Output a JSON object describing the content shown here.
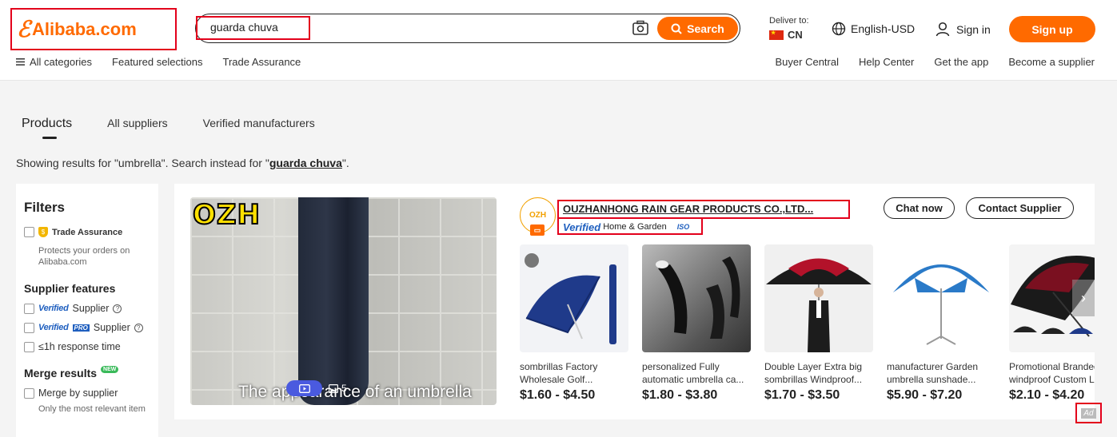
{
  "header": {
    "logo_mark": "ℰ",
    "logo_text": "Alibaba.com",
    "search": {
      "query": "guarda chuva",
      "button_label": "Search"
    },
    "deliver": {
      "label": "Deliver to:",
      "country": "CN"
    },
    "language": "English-USD",
    "sign_in": "Sign in",
    "sign_up": "Sign up",
    "nav_left": [
      "All categories",
      "Featured selections",
      "Trade Assurance"
    ],
    "nav_right": [
      "Buyer Central",
      "Help Center",
      "Get the app",
      "Become a supplier"
    ]
  },
  "tabs": [
    "Products",
    "All suppliers",
    "Verified manufacturers"
  ],
  "showing": {
    "prefix": "Showing results for \"umbrella\". Search instead for \"",
    "query": "guarda chuva",
    "suffix": "\"."
  },
  "filters": {
    "title": "Filters",
    "trade_assurance": {
      "label": "Trade Assurance",
      "note": "Protects your orders on Alibaba.com"
    },
    "supplier_features": {
      "title": "Supplier features",
      "items": [
        {
          "badge": "Verified",
          "label": "Supplier"
        },
        {
          "badge": "Verified",
          "pro": "PRO",
          "label": "Supplier"
        },
        {
          "label": "≤1h response time"
        }
      ]
    },
    "merge": {
      "title": "Merge results",
      "new_badge": "NEW",
      "item": "Merge by supplier",
      "note": "Only the most relevant item"
    }
  },
  "card": {
    "video": {
      "brand": "OZH",
      "caption": "The appearance of an umbrella",
      "image_count": "5"
    },
    "supplier": {
      "logo_text": "OZH",
      "name": "OUZHANHONG RAIN GEAR PRODUCTS CO.,LTD...",
      "verified": "Verified",
      "category": "Home & Garden",
      "iso": "ISO"
    },
    "chat_label": "Chat now",
    "contact_label": "Contact Supplier",
    "products": [
      {
        "title1": "sombrillas Factory",
        "title2": "Wholesale Golf...",
        "price": "$1.60 - $4.50"
      },
      {
        "title1": "personalized Fully",
        "title2": "automatic umbrella ca...",
        "price": "$1.80 - $3.80"
      },
      {
        "title1": "Double Layer Extra big",
        "title2": "sombrillas Windproof...",
        "price": "$1.70 - $3.50"
      },
      {
        "title1": "manufacturer Garden",
        "title2": "umbrella sunshade...",
        "price": "$5.90 - $7.20"
      },
      {
        "title1": "Promotional Branded",
        "title2": "windproof Custom L...",
        "price": "$2.10 - $4.20"
      }
    ],
    "ad_label": "Ad"
  },
  "colors": {
    "accent": "#ff6a00",
    "highlight_box": "#e3001b",
    "verified_blue": "#1f5fbf"
  }
}
